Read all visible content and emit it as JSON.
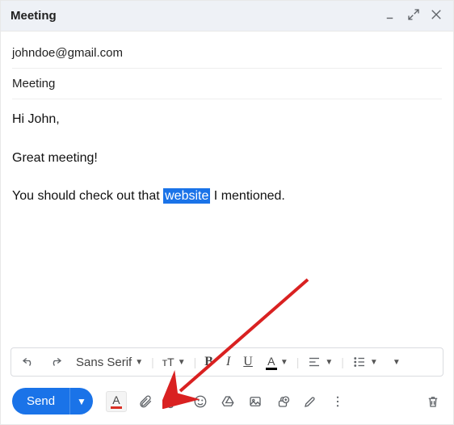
{
  "titlebar": {
    "title": "Meeting"
  },
  "fields": {
    "to": "johndoe@gmail.com",
    "subject": "Meeting"
  },
  "body": {
    "greeting": "Hi John,",
    "line1": "Great meeting!",
    "line2_pre": "You should check out that ",
    "line2_highlight": "website",
    "line2_post": " I mentioned."
  },
  "format": {
    "font_name": "Sans Serif",
    "size_label": "тT",
    "bold": "B",
    "italic": "I",
    "underline": "U",
    "textcolor": "A"
  },
  "bottom": {
    "send": "Send"
  }
}
